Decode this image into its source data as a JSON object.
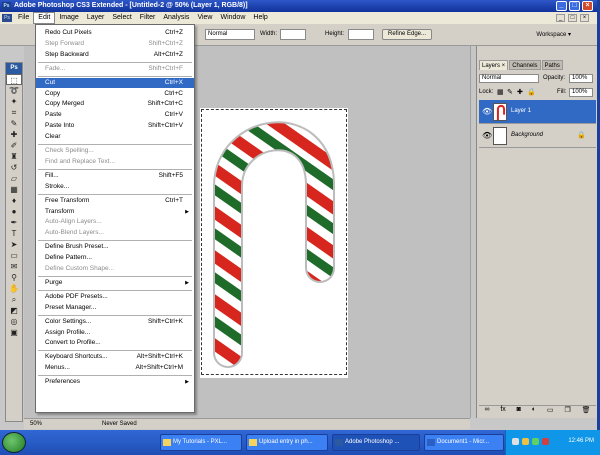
{
  "titlebar": {
    "text": "Adobe Photoshop CS3 Extended - [Untitled-2 @ 50% (Layer 1, RGB/8)]",
    "app_icon": "Ps",
    "buttons": [
      "_",
      "□",
      "×"
    ]
  },
  "menubar": {
    "items": [
      "File",
      "Edit",
      "Image",
      "Layer",
      "Select",
      "Filter",
      "Analysis",
      "View",
      "Window",
      "Help"
    ],
    "active": "Edit",
    "mdi_buttons": [
      "_",
      "□",
      "×"
    ]
  },
  "options_bar": {
    "style_value": "Normal",
    "width_label": "Width:",
    "height_label": "Height:",
    "refine_edge": "Refine Edge...",
    "workspace": "Workspace ▾"
  },
  "toolbox": {
    "logo": "Ps",
    "tools": [
      "marquee-tool",
      "lasso-tool",
      "magic-wand-tool",
      "crop-tool",
      "slice-tool",
      "healing-brush-tool",
      "brush-tool",
      "clone-stamp-tool",
      "history-brush-tool",
      "eraser-tool",
      "gradient-tool",
      "blur-tool",
      "dodge-tool",
      "pen-tool",
      "type-tool",
      "path-selection-tool",
      "shape-tool",
      "notes-tool",
      "eyedropper-tool",
      "hand-tool",
      "zoom-tool",
      "color-swatches",
      "quick-mask",
      "screen-mode"
    ]
  },
  "edit_menu": {
    "items": [
      {
        "label": "Redo Cut Pixels",
        "shortcut": "Ctrl+Z",
        "state": "enabled"
      },
      {
        "label": "Step Forward",
        "shortcut": "Shift+Ctrl+Z",
        "state": "disabled"
      },
      {
        "label": "Step Backward",
        "shortcut": "Alt+Ctrl+Z",
        "state": "enabled"
      },
      {
        "sep": true
      },
      {
        "label": "Fade...",
        "shortcut": "Shift+Ctrl+F",
        "state": "disabled"
      },
      {
        "sep": true
      },
      {
        "label": "Cut",
        "shortcut": "Ctrl+X",
        "state": "highlighted"
      },
      {
        "label": "Copy",
        "shortcut": "Ctrl+C",
        "state": "enabled"
      },
      {
        "label": "Copy Merged",
        "shortcut": "Shift+Ctrl+C",
        "state": "enabled"
      },
      {
        "label": "Paste",
        "shortcut": "Ctrl+V",
        "state": "enabled"
      },
      {
        "label": "Paste Into",
        "shortcut": "Shift+Ctrl+V",
        "state": "enabled"
      },
      {
        "label": "Clear",
        "shortcut": "",
        "state": "enabled"
      },
      {
        "sep": true
      },
      {
        "label": "Check Spelling...",
        "shortcut": "",
        "state": "disabled"
      },
      {
        "label": "Find and Replace Text...",
        "shortcut": "",
        "state": "disabled"
      },
      {
        "sep": true
      },
      {
        "label": "Fill...",
        "shortcut": "Shift+F5",
        "state": "enabled"
      },
      {
        "label": "Stroke...",
        "shortcut": "",
        "state": "enabled"
      },
      {
        "sep": true
      },
      {
        "label": "Free Transform",
        "shortcut": "Ctrl+T",
        "state": "enabled"
      },
      {
        "label": "Transform",
        "shortcut": "",
        "state": "enabled",
        "submenu": true
      },
      {
        "label": "Auto-Align Layers...",
        "shortcut": "",
        "state": "disabled"
      },
      {
        "label": "Auto-Blend Layers...",
        "shortcut": "",
        "state": "disabled"
      },
      {
        "sep": true
      },
      {
        "label": "Define Brush Preset...",
        "shortcut": "",
        "state": "enabled"
      },
      {
        "label": "Define Pattern...",
        "shortcut": "",
        "state": "enabled"
      },
      {
        "label": "Define Custom Shape...",
        "shortcut": "",
        "state": "disabled"
      },
      {
        "sep": true
      },
      {
        "label": "Purge",
        "shortcut": "",
        "state": "enabled",
        "submenu": true
      },
      {
        "sep": true
      },
      {
        "label": "Adobe PDF Presets...",
        "shortcut": "",
        "state": "enabled"
      },
      {
        "label": "Preset Manager...",
        "shortcut": "",
        "state": "enabled"
      },
      {
        "sep": true
      },
      {
        "label": "Color Settings...",
        "shortcut": "Shift+Ctrl+K",
        "state": "enabled"
      },
      {
        "label": "Assign Profile...",
        "shortcut": "",
        "state": "enabled"
      },
      {
        "label": "Convert to Profile...",
        "shortcut": "",
        "state": "enabled"
      },
      {
        "sep": true
      },
      {
        "label": "Keyboard Shortcuts...",
        "shortcut": "Alt+Shift+Ctrl+K",
        "state": "enabled"
      },
      {
        "label": "Menus...",
        "shortcut": "Alt+Shift+Ctrl+M",
        "state": "enabled"
      },
      {
        "sep": true
      },
      {
        "label": "Preferences",
        "shortcut": "",
        "state": "enabled",
        "submenu": true
      }
    ]
  },
  "layers_panel": {
    "tabs": [
      "Layers ×",
      "Channels",
      "Paths"
    ],
    "blend_mode": "Normal",
    "opacity_label": "Opacity:",
    "opacity_value": "100%",
    "lock_label": "Lock:",
    "fill_label": "Fill:",
    "fill_value": "100%",
    "layers": [
      {
        "name": "Layer 1",
        "selected": true,
        "italic": false
      },
      {
        "name": "Background",
        "selected": false,
        "italic": true
      }
    ],
    "bottom_icons": [
      "link-icon",
      "fx-icon",
      "mask-icon",
      "adjustment-icon",
      "group-icon",
      "new-layer-icon",
      "trash-icon"
    ]
  },
  "status_bar": {
    "zoom": "50%",
    "info": "Never Saved"
  },
  "colors": {
    "title_blue": "#11329a",
    "highlight": "#316ac5",
    "candy_red": "#d7261e",
    "candy_green": "#1f6b2a"
  },
  "taskbar": {
    "tasks": [
      {
        "label": "My Tutorials - PXL...",
        "active": false
      },
      {
        "label": "Upload entry in ph...",
        "active": false
      },
      {
        "label": "Adobe Photoshop ...",
        "active": true
      },
      {
        "label": "Document1 - Micr...",
        "active": false
      }
    ],
    "clock": "12:46 PM"
  }
}
